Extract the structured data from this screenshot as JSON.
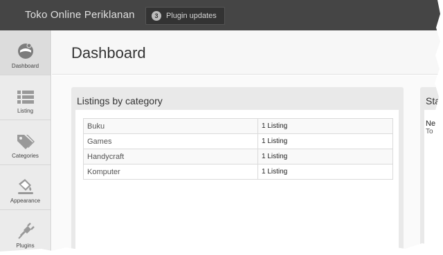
{
  "topbar": {
    "site_title": "Toko Online Periklanan",
    "updates_count": "3",
    "updates_label": "Plugin updates"
  },
  "sidebar": {
    "items": [
      {
        "label": "Dashboard",
        "icon": "dashboard-icon",
        "active": true
      },
      {
        "label": "Listing",
        "icon": "list-icon"
      },
      {
        "label": "Categories",
        "icon": "tag-icon"
      },
      {
        "label": "Appearance",
        "icon": "paint-bucket-icon"
      },
      {
        "label": "Plugins",
        "icon": "plug-icon"
      }
    ]
  },
  "header": {
    "title": "Dashboard"
  },
  "listings_panel": {
    "title": "Listings by category",
    "rows": [
      {
        "category": "Buku",
        "count": "1 Listing"
      },
      {
        "category": "Games",
        "count": "1 Listing"
      },
      {
        "category": "Handycraft",
        "count": "1 Listing"
      },
      {
        "category": "Komputer",
        "count": "1 Listing"
      }
    ]
  },
  "stats_panel": {
    "title": "Sta",
    "line1": "Ne",
    "line2": "To"
  },
  "colors": {
    "topbar": "#454545",
    "sidebar": "#ebebeb",
    "panel": "#e9e9e9",
    "icon": "#999999"
  }
}
